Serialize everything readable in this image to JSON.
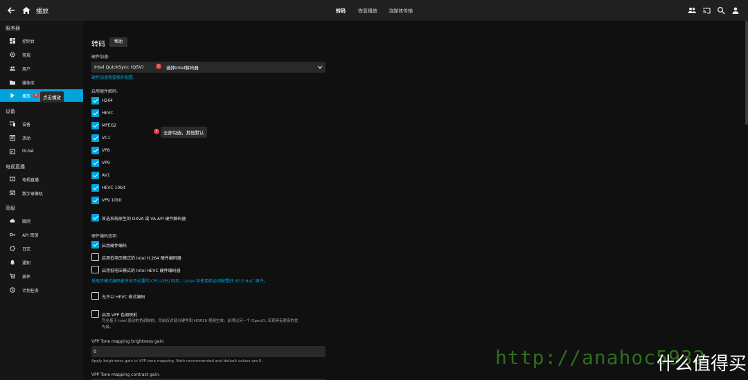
{
  "topbar": {
    "title": "播放",
    "tabs": [
      "转码",
      "恢复播放",
      "流媒体传输"
    ]
  },
  "sidebar": {
    "sections": [
      {
        "label": "服务器",
        "items": [
          {
            "label": "控制台",
            "icon": "dashboard-icon"
          },
          {
            "label": "常规",
            "icon": "gear-icon"
          },
          {
            "label": "用户",
            "icon": "users-icon"
          },
          {
            "label": "媒体库",
            "icon": "folder-icon"
          },
          {
            "label": "播放",
            "icon": "play-icon",
            "active": true
          }
        ]
      },
      {
        "label": "设备",
        "items": [
          {
            "label": "设备",
            "icon": "devices-icon"
          },
          {
            "label": "活动",
            "icon": "activity-icon"
          },
          {
            "label": "DLNA",
            "icon": "dlna-icon"
          }
        ]
      },
      {
        "label": "电视直播",
        "items": [
          {
            "label": "电视直播",
            "icon": "tv-icon"
          },
          {
            "label": "数字录像机",
            "icon": "dvr-icon"
          }
        ]
      },
      {
        "label": "高级",
        "items": [
          {
            "label": "联网",
            "icon": "cloud-icon"
          },
          {
            "label": "API 密钥",
            "icon": "key-icon"
          },
          {
            "label": "日志",
            "icon": "log-icon"
          },
          {
            "label": "通知",
            "icon": "bell-icon"
          },
          {
            "label": "插件",
            "icon": "cart-icon"
          },
          {
            "label": "计划任务",
            "icon": "clock-icon"
          }
        ]
      }
    ]
  },
  "annotations": {
    "step1": {
      "num": "1",
      "text": "点击播放"
    },
    "step2": {
      "num": "2",
      "text": "选择intel解码器"
    },
    "step3": {
      "num": "3",
      "text": "全部勾选，其他默认"
    }
  },
  "main": {
    "heading": "转码",
    "help_label": "帮助",
    "hw_accel_label": "硬件加速:",
    "hw_accel_value": "Intel QuickSync (QSV)",
    "hw_accel_note": "硬件加速需要额外配置。",
    "hw_decode_label": "启用硬件解码:",
    "codecs": [
      "H264",
      "HEVC",
      "MPEG2",
      "VC1",
      "VP8",
      "VP9",
      "AV1",
      "HEVC 10bit",
      "VP9 10bit"
    ],
    "prefer_native": "首选系统原生的 DXVA 或 VA-API 硬件解码器",
    "encode_options_label": "硬件编码选项:",
    "enable_hw_encode": "启用硬件编码",
    "low_power_h264": "启用低电压模式的 Intel H.264 硬件编码器",
    "low_power_hevc": "启用低电压模式的 Intel HEVC 硬件编码器",
    "low_power_note": "低电压模式编码能节省不必要的 CPU-GPU 同步。Linux 中使用前必须配置好 i915 HuC 固件。",
    "allow_hevc": "允许以 HEVC 格式编码",
    "vpp_tonemap": "启用 VPP 色调映射",
    "vpp_desc_1": "完全基于 Intel 驱动的色调映射。目前仅对部分硬件和 HDR10 视频生效。此项比另一个 OpenCL 实现具有更高的优",
    "vpp_desc_2": "先级。",
    "brightness_label": "VPP Tone mapping brightness gain:",
    "brightness_value": "0",
    "brightness_desc": "Apply brightness gain in VPP tone mapping. Both recommended and default values are 0.",
    "contrast_label": "VPP Tone mapping contrast gain:"
  },
  "watermark": {
    "url": "http://anahoc5932",
    "brand": "什么值得买"
  }
}
